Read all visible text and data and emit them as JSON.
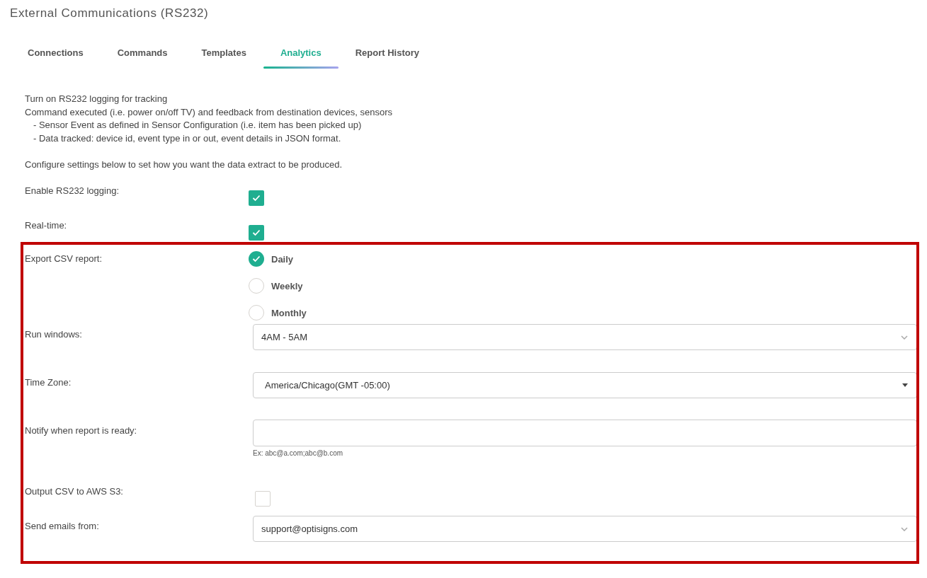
{
  "page_title": "External Communications (RS232)",
  "tabs": [
    {
      "label": "Connections",
      "selected": false
    },
    {
      "label": "Commands",
      "selected": false
    },
    {
      "label": "Templates",
      "selected": false
    },
    {
      "label": "Analytics",
      "selected": true
    },
    {
      "label": "Report History",
      "selected": false
    }
  ],
  "description": {
    "lines": [
      "Turn on RS232 logging for tracking",
      "Command executed (i.e. power on/off TV) and feedback from destination devices, sensors"
    ],
    "bullets": [
      "- Sensor Event as defined in Sensor Configuration (i.e. item has been picked up)",
      "- Data tracked: device id, event type in or out, event details in JSON format."
    ],
    "note": "Configure settings below to set how you want the data extract to be produced."
  },
  "settings": [
    {
      "kind": "checkbox",
      "label": "Enable RS232 logging:",
      "checked": true
    },
    {
      "kind": "checkbox",
      "label": "Real-time:",
      "checked": true
    }
  ],
  "highlighted_settings": [
    {
      "kind": "radio",
      "label": "Export CSV report:",
      "options": [
        {
          "label": "Daily",
          "selected": true
        },
        {
          "label": "Weekly",
          "selected": false
        },
        {
          "label": "Monthly",
          "selected": false
        }
      ]
    },
    {
      "kind": "select",
      "label": "Run windows:",
      "value": "4AM - 5AM"
    },
    {
      "kind": "dropdown",
      "label": "Time Zone:",
      "value": "America/Chicago(GMT -05:00)"
    },
    {
      "kind": "input",
      "label": "Notify when report is ready:",
      "hint": "Ex: abc@a.com;abc@b.com"
    },
    {
      "kind": "checkbox",
      "label": "Output CSV to AWS S3:",
      "checked": false
    },
    {
      "kind": "select",
      "label": "Send emails from:",
      "value": "support@optisigns.com"
    }
  ]
}
